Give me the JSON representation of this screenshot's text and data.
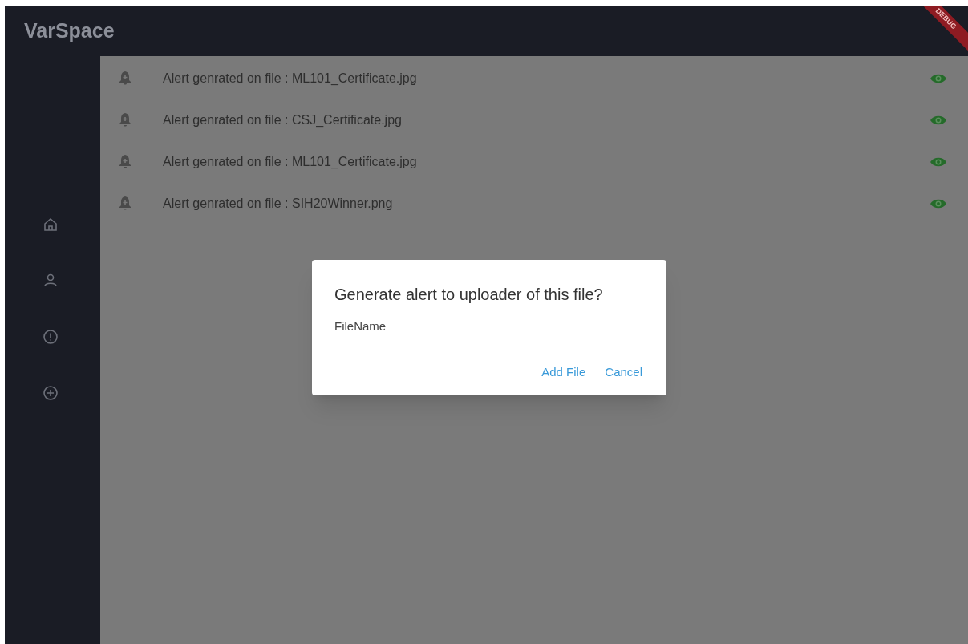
{
  "app_bar": {
    "title": "VarSpace",
    "debug_banner": "DEBUG"
  },
  "alerts": [
    {
      "text": "Alert genrated on file : ML101_Certificate.jpg"
    },
    {
      "text": "Alert genrated on file : CSJ_Certificate.jpg"
    },
    {
      "text": "Alert genrated on file : ML101_Certificate.jpg"
    },
    {
      "text": "Alert genrated on file : SIH20Winner.png"
    }
  ],
  "dialog": {
    "title": "Generate alert to uploader of this file?",
    "body": "FileName",
    "buttons": [
      "Add File",
      "Cancel"
    ]
  }
}
